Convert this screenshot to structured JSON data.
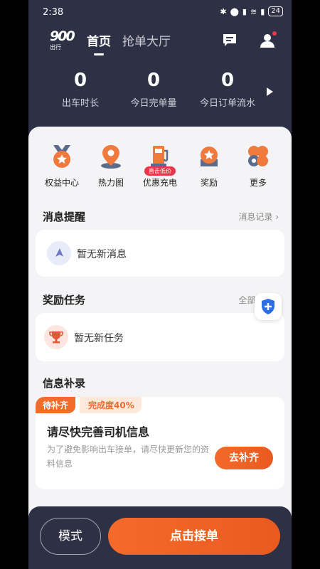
{
  "status_bar": {
    "time": "2:38",
    "battery": "24"
  },
  "header": {
    "logo_number": "900",
    "logo_text": "出行",
    "tabs": [
      {
        "label": "首页",
        "active": true
      },
      {
        "label": "抢单大厅",
        "active": false
      }
    ]
  },
  "stats": [
    {
      "value": "0",
      "label": "出车时长"
    },
    {
      "value": "0",
      "label": "今日完单量"
    },
    {
      "value": "0",
      "label": "今日订单流水"
    }
  ],
  "shortcuts": [
    {
      "label": "权益中心",
      "icon": "medal-icon"
    },
    {
      "label": "热力图",
      "icon": "location-pin-icon"
    },
    {
      "label": "优惠充电",
      "icon": "charging-station-icon",
      "badge": "直击低价"
    },
    {
      "label": "奖励",
      "icon": "reward-badge-icon"
    },
    {
      "label": "更多",
      "icon": "more-grid-icon"
    }
  ],
  "messages": {
    "title": "消息提醒",
    "link": "消息记录 ›",
    "empty_text": "暂无新消息"
  },
  "tasks": {
    "title": "奖励任务",
    "link": "全部任务 ›",
    "empty_text": "暂无新任务"
  },
  "info": {
    "title": "信息补录",
    "tag_pending": "待补齐",
    "tag_progress": "完成度40%",
    "card_title": "请尽快完善司机信息",
    "card_desc": "为了避免影响出车接单，请尽快更新您的资料信息",
    "button": "去补齐"
  },
  "bottom": {
    "mode_label": "模式",
    "accept_label": "点击接单"
  },
  "colors": {
    "primary": "#f26b2b",
    "header_bg": "#2e3045",
    "badge_red": "#e8384b"
  }
}
